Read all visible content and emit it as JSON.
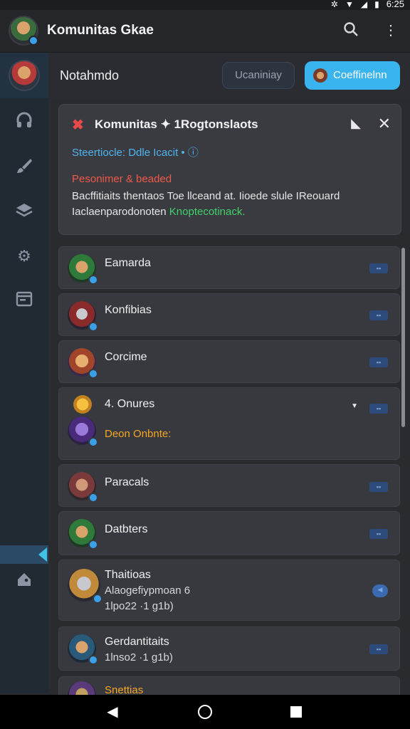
{
  "status_bar": {
    "time": "6:25"
  },
  "app_bar": {
    "title": "Komunitas Gkae"
  },
  "header": {
    "title": "Notahmdo",
    "outline_button": "Ucaniniay",
    "primary_button": "Coeffinelnn"
  },
  "notice": {
    "title": "Komunitas ✦ 1Rogtonslaots",
    "subtitle": "Steertiocle: Ddle Icacit • ⓘ",
    "red_line": "Pesonimer & beaded",
    "body_line1": "Bacffitiaits thentaos Toe llceand at. Iioede slule IReouard",
    "body_line2_prefix": "Iaclaenparodonoten ",
    "body_line2_green": "Knoptecotinack."
  },
  "list": [
    {
      "name": "Eamarda"
    },
    {
      "name": "Konfibias"
    },
    {
      "name": "Corcime"
    },
    {
      "name": "4. Onures",
      "orange": "Deon Onbnte:"
    },
    {
      "name": "Paracals"
    },
    {
      "name": "Datbters"
    },
    {
      "name": "Thaitioas",
      "sub1": "Alaogefiypmoan 6",
      "sub2": "1lpo22 ·1 g1b)"
    },
    {
      "name": "Gerdantitaits",
      "sub1": "1lnso2 ·1 g1b)"
    },
    {
      "name": "Snettias"
    }
  ],
  "colors": {
    "accent": "#3ab4ef",
    "red": "#e84a4a",
    "green": "#3fd26a",
    "orange": "#f5a623"
  }
}
